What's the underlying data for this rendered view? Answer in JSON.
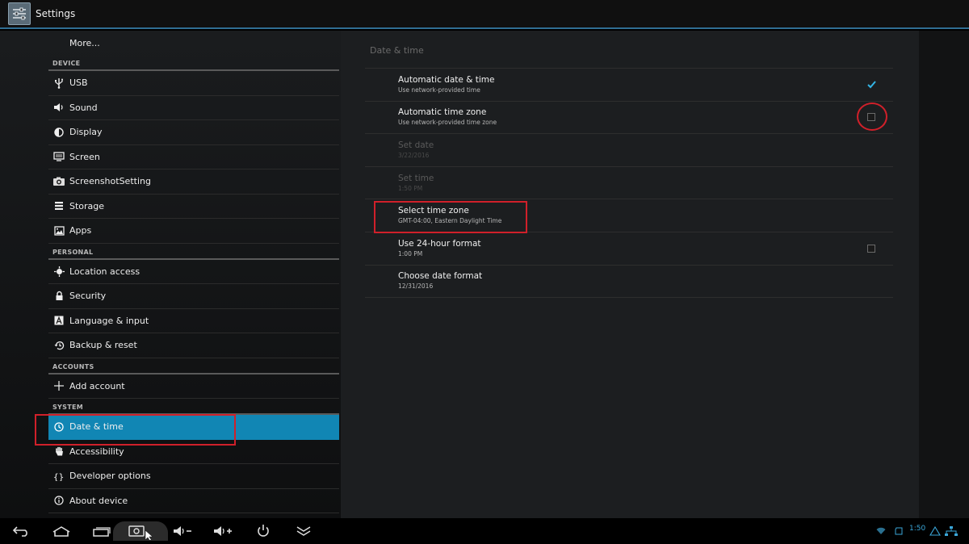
{
  "app": {
    "title": "Settings",
    "icon": "settings-sliders-icon"
  },
  "left_panel": {
    "more_label": "More...",
    "categories": {
      "device": "DEVICE",
      "personal": "PERSONAL",
      "accounts": "ACCOUNTS",
      "system": "SYSTEM"
    },
    "items": {
      "usb": {
        "label": "USB",
        "icon": "usb-icon"
      },
      "sound": {
        "label": "Sound",
        "icon": "speaker-icon"
      },
      "display": {
        "label": "Display",
        "icon": "display-contrast-icon"
      },
      "screen": {
        "label": "Screen",
        "icon": "monitor-icon"
      },
      "screenshot": {
        "label": "ScreenshotSetting",
        "icon": "camera-icon"
      },
      "storage": {
        "label": "Storage",
        "icon": "storage-lines-icon"
      },
      "apps": {
        "label": "Apps",
        "icon": "image-icon"
      },
      "location": {
        "label": "Location access",
        "icon": "location-target-icon"
      },
      "security": {
        "label": "Security",
        "icon": "lock-icon"
      },
      "language": {
        "label": "Language & input",
        "icon": "language-a-icon"
      },
      "backup": {
        "label": "Backup & reset",
        "icon": "restore-clock-icon"
      },
      "add_account": {
        "label": "Add account",
        "icon": "plus-icon"
      },
      "date_time": {
        "label": "Date & time",
        "icon": "clock-icon",
        "selected": true
      },
      "accessibility": {
        "label": "Accessibility",
        "icon": "hand-icon"
      },
      "developer": {
        "label": "Developer options",
        "icon": "braces-icon"
      },
      "about": {
        "label": "About device",
        "icon": "info-icon"
      }
    }
  },
  "right_panel": {
    "title": "Date & time",
    "prefs": {
      "auto_date": {
        "title": "Automatic date & time",
        "summary": "Use network-provided time",
        "checked": true
      },
      "auto_zone": {
        "title": "Automatic time zone",
        "summary": "Use network-provided time zone",
        "checked": false
      },
      "set_date": {
        "title": "Set date",
        "summary": "3/22/2016",
        "disabled": true
      },
      "set_time": {
        "title": "Set time",
        "summary": "1:50 PM",
        "disabled": true
      },
      "time_zone": {
        "title": "Select time zone",
        "summary": "GMT-04:00, Eastern Daylight Time"
      },
      "hour24": {
        "title": "Use 24-hour format",
        "summary": "1:00 PM",
        "checked": false
      },
      "date_format": {
        "title": "Choose date format",
        "summary": "12/31/2016"
      }
    }
  },
  "navbar": {
    "buttons": [
      "back-icon",
      "home-icon",
      "recent-apps-icon",
      "screenshot-icon",
      "volume-down-icon",
      "volume-up-icon",
      "power-icon",
      "collapse-chevrons-icon"
    ],
    "status": {
      "time": "1:50",
      "icons": [
        "wifi-icon",
        "sd-card-icon",
        "warning-triangle-icon",
        "network-icon"
      ]
    }
  },
  "colors": {
    "accent": "#1186b4",
    "annotation": "#d0202a",
    "background": "#1c1e20"
  }
}
